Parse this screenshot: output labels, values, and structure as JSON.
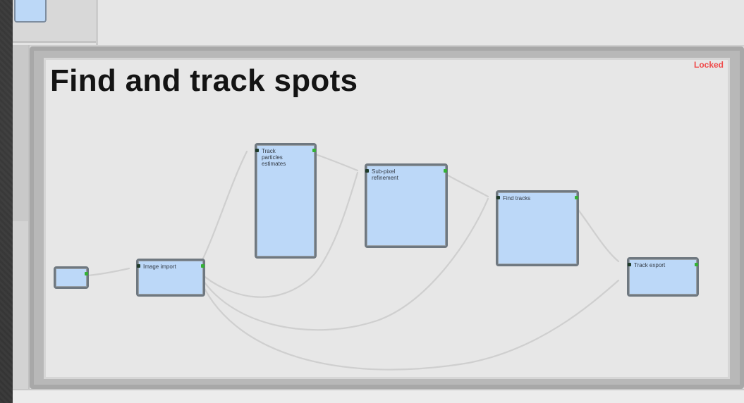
{
  "panel": {
    "title": "Find and track spots",
    "status": "Locked"
  },
  "colors": {
    "node_fill": "#bcd8f8",
    "node_border": "#6f7880",
    "wire": "#c9c9c9",
    "status": "#ef4b4b"
  },
  "nodes": [
    {
      "id": "source",
      "label": ""
    },
    {
      "id": "image-import",
      "label": "Image import"
    },
    {
      "id": "detector",
      "label": "Track\nparticles\nestimates"
    },
    {
      "id": "refiner",
      "label": "Sub-pixel\nrefinement"
    },
    {
      "id": "linker",
      "label": "Find tracks"
    },
    {
      "id": "output",
      "label": "Track export"
    }
  ]
}
